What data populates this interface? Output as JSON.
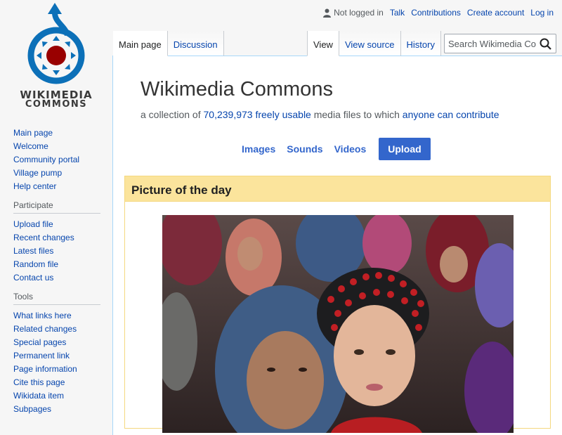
{
  "logo": {
    "line1": "WIKIMEDIA",
    "line2": "COMMONS"
  },
  "personal": {
    "not_logged_in": "Not logged in",
    "talk": "Talk",
    "contributions": "Contributions",
    "create_account": "Create account",
    "log_in": "Log in"
  },
  "tabs": {
    "main_page": "Main page",
    "discussion": "Discussion",
    "view": "View",
    "view_source": "View source",
    "history": "History"
  },
  "search": {
    "placeholder": "Search Wikimedia Commons"
  },
  "page": {
    "title": "Wikimedia Commons",
    "tagline_prefix": "a collection of ",
    "count_link": "70,239,973 freely usable",
    "tagline_middle": " media files to which ",
    "contribute_link": "anyone can contribute"
  },
  "media_nav": {
    "images": "Images",
    "sounds": "Sounds",
    "videos": "Videos",
    "upload": "Upload"
  },
  "potd": {
    "title": "Picture of the day"
  },
  "sidebar": {
    "nav": [
      "Main page",
      "Welcome",
      "Community portal",
      "Village pump",
      "Help center"
    ],
    "participate_heading": "Participate",
    "participate": [
      "Upload file",
      "Recent changes",
      "Latest files",
      "Random file",
      "Contact us"
    ],
    "tools_heading": "Tools",
    "tools": [
      "What links here",
      "Related changes",
      "Special pages",
      "Permanent link",
      "Page information",
      "Cite this page",
      "Wikidata item",
      "Subpages"
    ]
  },
  "colors": {
    "link": "#0645ad",
    "accent": "#3366cc",
    "potd_header": "#fbe49c",
    "logo_blue": "#0c70b8",
    "logo_red": "#990000"
  }
}
